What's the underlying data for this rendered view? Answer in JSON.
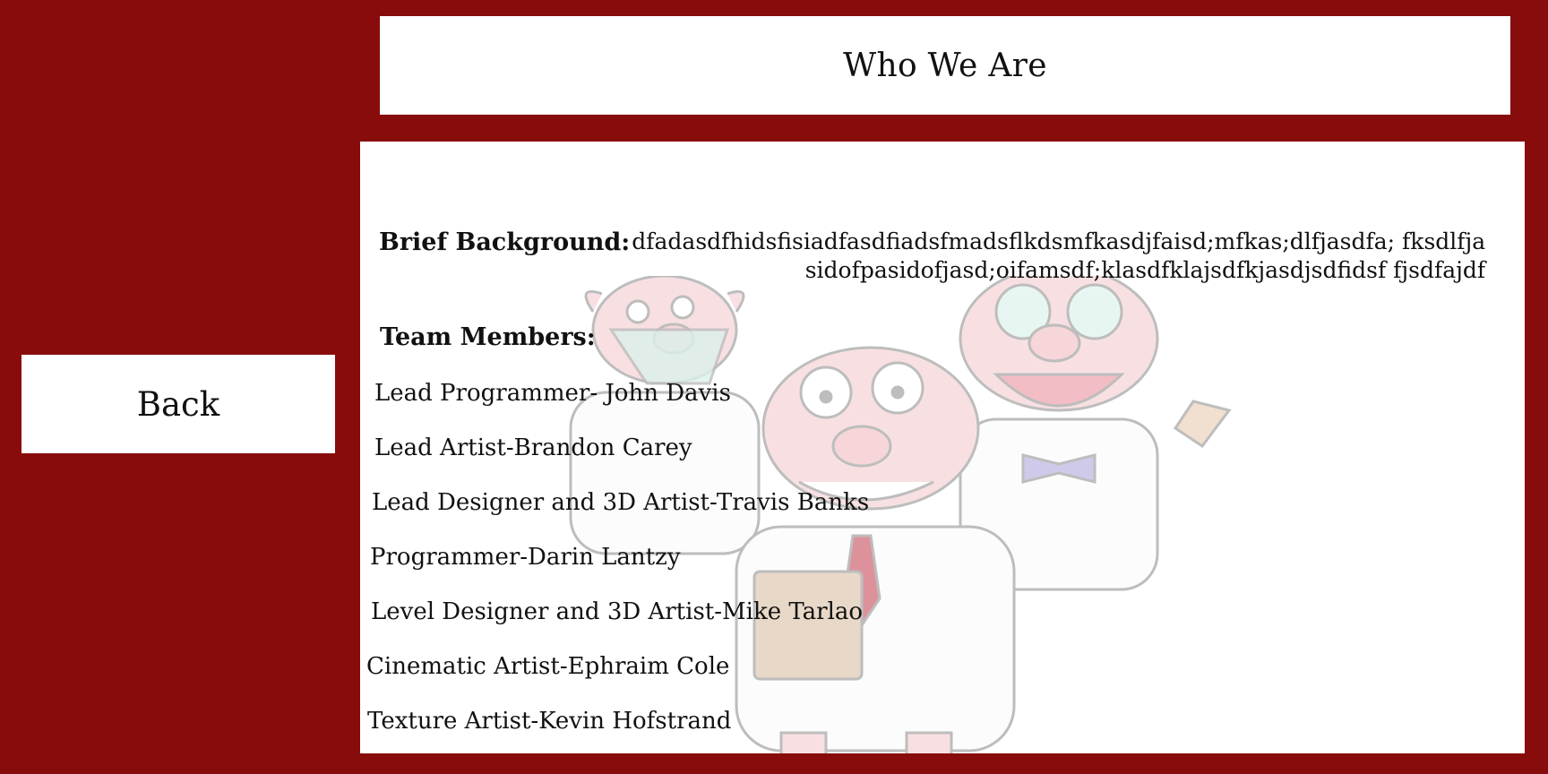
{
  "header": {
    "title": "Who We Are"
  },
  "nav": {
    "back_label": "Back"
  },
  "about": {
    "background_label": "Brief Background:",
    "background_text": "dfadasdfhidsfisiadfasdfiadsfmadsflkdsmfkasdjfaisd;mfkas;dlfjasdfa; fksdlfjasidofpasidofjasd;oifamsdf;klasdfklajsdfkjasdjsdfidsf fjsdfajdf",
    "team_heading": "Team Members:",
    "members": [
      "Lead Programmer- John Davis",
      "Lead Artist-Brandon Carey",
      "Lead Designer and 3D Artist-Travis Banks",
      "Programmer-Darin Lantzy",
      "Level Designer and 3D Artist-Mike Tarlao",
      "Cinematic Artist-Ephraim Cole",
      "Texture Artist-Kevin Hofstrand"
    ]
  },
  "colors": {
    "page_background": "#880c0c",
    "panel_background": "#ffffff",
    "text": "#111111"
  },
  "illustration": {
    "icon": "three-pig-scientists-illustration"
  }
}
